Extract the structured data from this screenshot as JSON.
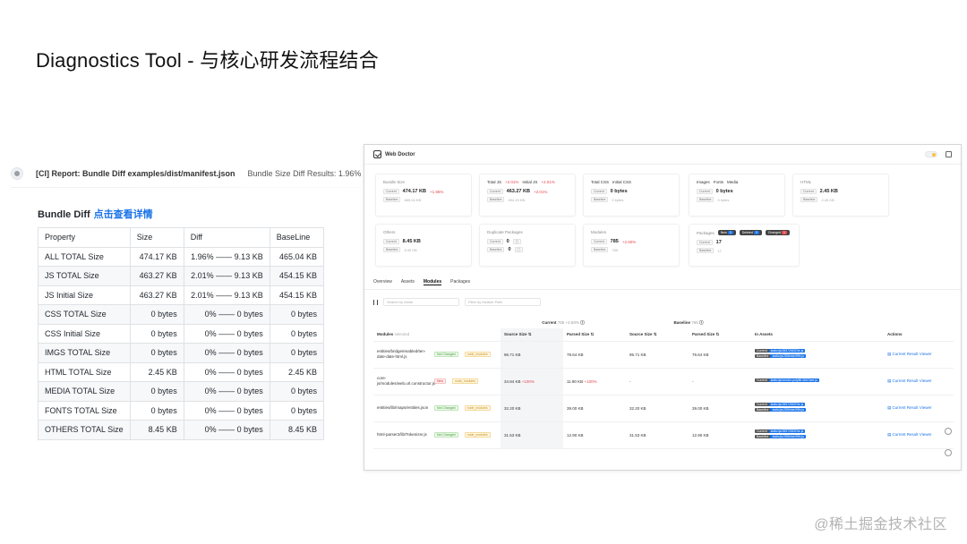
{
  "slide": {
    "title": "Diagnostics Tool - 与核心研发流程结合"
  },
  "ci": {
    "title": "[CI] Report: Bundle Diff examples/dist/manifest.json",
    "result": "Bundle Size Diff Results: 1.96%"
  },
  "bundle_diff": {
    "heading": "Bundle Diff",
    "link": "点击查看详情",
    "columns": [
      "Property",
      "Size",
      "Diff",
      "BaseLine"
    ],
    "rows": [
      {
        "property": "ALL TOTAL Size",
        "size": "474.17 KB",
        "diff": "1.96% —— 9.13 KB",
        "baseline": "465.04 KB"
      },
      {
        "property": "JS TOTAL Size",
        "size": "463.27 KB",
        "diff": "2.01% —— 9.13 KB",
        "baseline": "454.15 KB"
      },
      {
        "property": "JS Initial Size",
        "size": "463.27 KB",
        "diff": "2.01% —— 9.13 KB",
        "baseline": "454.15 KB"
      },
      {
        "property": "CSS TOTAL Size",
        "size": "0 bytes",
        "diff": "0% —— 0 bytes",
        "baseline": "0 bytes"
      },
      {
        "property": "CSS Initial Size",
        "size": "0 bytes",
        "diff": "0% —— 0 bytes",
        "baseline": "0 bytes"
      },
      {
        "property": "IMGS TOTAL Size",
        "size": "0 bytes",
        "diff": "0% —— 0 bytes",
        "baseline": "0 bytes"
      },
      {
        "property": "HTML TOTAL Size",
        "size": "2.45 KB",
        "diff": "0% —— 0 bytes",
        "baseline": "2.45 KB"
      },
      {
        "property": "MEDIA TOTAL Size",
        "size": "0 bytes",
        "diff": "0% —— 0 bytes",
        "baseline": "0 bytes"
      },
      {
        "property": "FONTS TOTAL Size",
        "size": "0 bytes",
        "diff": "0% —— 0 bytes",
        "baseline": "0 bytes"
      },
      {
        "property": "OTHERS TOTAL Size",
        "size": "8.45 KB",
        "diff": "0% —— 0 bytes",
        "baseline": "8.45 KB"
      }
    ]
  },
  "web_doctor": {
    "brand": "Web Doctor",
    "tags": {
      "current": "Current",
      "baseline": "Baseline"
    },
    "cards": {
      "bundle_size": {
        "title": "Bundle Size",
        "current": "474.17 KB",
        "change": "+1.96%",
        "baseline": "465.04 KB"
      },
      "js": {
        "title_total": "Total JS",
        "total_change": "+2.01%",
        "title_initial": "Initial JS",
        "initial_change": "+2.01%",
        "current": "463.27 KB",
        "change": "+2.01%",
        "baseline": "454.15 KB"
      },
      "css": {
        "title_total": "Total CSS",
        "title_initial": "Initial CSS",
        "current": "0 bytes",
        "baseline": "0 bytes"
      },
      "images": {
        "t1": "Images",
        "t2": "Fonts",
        "t3": "Media",
        "current": "0 bytes",
        "baseline": "0 bytes"
      },
      "html": {
        "title": "HTML",
        "current": "2.45 KB",
        "baseline": "2.45 KB"
      },
      "others": {
        "title": "Others",
        "current": "8.45 KB",
        "baseline": "8.45 KB"
      },
      "duplicate": {
        "title": "Duplicate Packages",
        "current": "0",
        "baseline": "0"
      },
      "modules": {
        "title": "Modules",
        "current": "785",
        "change": "+2.60%",
        "baseline": "765"
      },
      "packages": {
        "title": "Packages",
        "new_label": "New",
        "new_count": "0",
        "deleted_label": "Deleted",
        "deleted_count": "0",
        "changed_label": "Changed",
        "changed_count": "1",
        "current": "17",
        "baseline": "17"
      }
    },
    "tabs": [
      "Overview",
      "Assets",
      "Modules",
      "Packages"
    ],
    "search_placeholder": "Search by name",
    "filter_placeholder": "Filter by Module Path",
    "table": {
      "group_current": "Current",
      "group_current_note": "785 +2.60%",
      "group_baseline": "Baseline",
      "group_baseline_note": "765",
      "modules_label": "Modules",
      "modules_note": "selected",
      "cols": [
        "Source Size",
        "Parsed Size",
        "Source Size",
        "Parsed Size"
      ],
      "in_assets": "In Assets",
      "actions": "Actions",
      "rows": [
        {
          "path": "entities/bridge/enabled/ten-date-date-html.js",
          "t1": "Not Changed",
          "t2": "node_modules",
          "src": "96.71 KB",
          "src_change": "",
          "parsed": "78.64 KB",
          "parsed_change": "",
          "bsrc": "95.71 KB",
          "bparsed": "76.64 KB",
          "assets": [
            {
              "kind": "Current",
              "file": "static/js/285725DE0e.js"
            },
            {
              "kind": "Baseline",
              "file": "static/js/285bfde0f9b.js"
            }
          ],
          "action": "Current Result Viewer"
        },
        {
          "path": "core-js/modules/web.url.constructor.js",
          "t1": "New",
          "t2": "node_modules",
          "src": "34.84 KB",
          "src_change": "+100%",
          "parsed": "11.90 KB",
          "parsed_change": "+100%",
          "bsrc": "-",
          "bparsed": "-",
          "assets": [
            {
              "kind": "Current",
              "file": "static/js/vendor-polyfill.4bb7aee.js"
            }
          ],
          "action": "Current Result Viewer"
        },
        {
          "path": "entities/lib/maps/entities.json",
          "t1": "Not Changed",
          "t2": "node_modules",
          "src": "32.20 KB",
          "src_change": "",
          "parsed": "39.00 KB",
          "parsed_change": "",
          "bsrc": "32.20 KB",
          "bparsed": "39.00 KB",
          "assets": [
            {
              "kind": "Current",
              "file": "static/js/285725DE0e.js"
            },
            {
              "kind": "Baseline",
              "file": "static/js/285bfde0f9b.js"
            }
          ],
          "action": "Current Result Viewer"
        },
        {
          "path": "html-parser2/lib/Tokenizer.js",
          "t1": "Not Changed",
          "t2": "node_modules",
          "src": "31.53 KB",
          "src_change": "",
          "parsed": "12.90 KB",
          "parsed_change": "",
          "bsrc": "31.53 KB",
          "bparsed": "12.90 KB",
          "assets": [
            {
              "kind": "Current",
              "file": "static/js/285725DE0e.js"
            },
            {
              "kind": "Baseline",
              "file": "static/js/285bfde0f9b.js"
            }
          ],
          "action": "Current Result Viewer"
        }
      ]
    }
  },
  "watermark": "@稀土掘金技术社区"
}
